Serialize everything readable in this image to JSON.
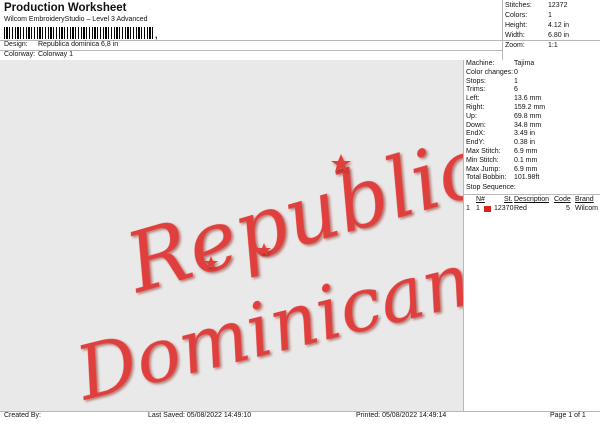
{
  "header": {
    "title": "Production Worksheet",
    "subtitle": "Wilcom EmbroideryStudio – Level 3 Advanced",
    "barcode_suffix": ","
  },
  "summary": {
    "stitches_label": "Stitches:",
    "stitches": "12372",
    "colors_label": "Colors:",
    "colors": "1",
    "height_label": "Height:",
    "height": "4.12 in",
    "width_label": "Width:",
    "width": "6.80 in",
    "zoom_label": "Zoom:",
    "zoom": "1:1"
  },
  "info": {
    "design_label": "Design:",
    "design": "Republica dominica 6,8 in",
    "colorway_label": "Colorway:",
    "colorway": "Colorway 1"
  },
  "design_preview": {
    "line1": "Republica",
    "line2": "Dominicana",
    "thread_color": "#e0413c"
  },
  "machine_panel": {
    "rows": [
      {
        "label": "Machine:",
        "value": "Tajima"
      },
      {
        "label": "Color changes:",
        "value": "0"
      },
      {
        "label": "Stops:",
        "value": "1"
      },
      {
        "label": "Trims:",
        "value": "6"
      },
      {
        "label": "Left:",
        "value": "13.6 mm"
      },
      {
        "label": "Right:",
        "value": "159.2 mm"
      },
      {
        "label": "Up:",
        "value": "69.8 mm"
      },
      {
        "label": "Down:",
        "value": "34.8 mm"
      },
      {
        "label": "EndX:",
        "value": "3.49 in"
      },
      {
        "label": "EndY:",
        "value": "0.38 in"
      },
      {
        "label": "Max Stitch:",
        "value": "6.9 mm"
      },
      {
        "label": "Min Stitch:",
        "value": "0.1 mm"
      },
      {
        "label": "Max Jump:",
        "value": "6.9 mm"
      },
      {
        "label": "Total Bobbin:",
        "value": "101.98ft"
      }
    ],
    "stop_sequence_label": "Stop Sequence:",
    "columns": {
      "n": "N#",
      "st": "St.",
      "description": "Description",
      "code": "Code",
      "brand": "Brand"
    },
    "sequence": [
      {
        "idx": "1",
        "n": "1",
        "swatch": "#d9261c",
        "st": "12370",
        "description": "Red",
        "code": "5",
        "brand": "Wilcom"
      }
    ]
  },
  "footer": {
    "created_by": "Created By:",
    "last_saved": "Last Saved: 05/08/2022 14:49:10",
    "printed": "Printed: 05/08/2022 14:49:14",
    "page": "Page 1 of 1"
  }
}
